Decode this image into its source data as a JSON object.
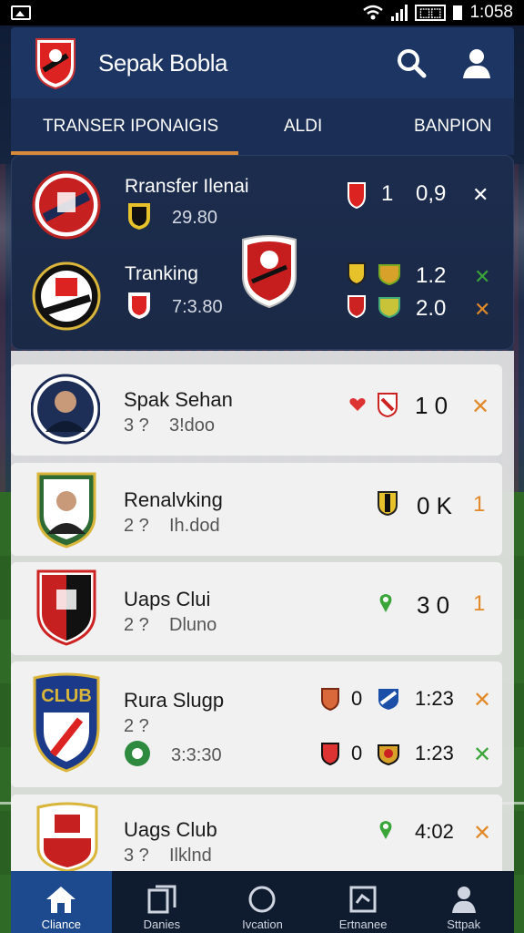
{
  "status_bar": {
    "time": "1:058",
    "battery_label": "⬚⬚"
  },
  "header": {
    "title": "Sepak Bobla"
  },
  "tabs": [
    {
      "label": "TRANSER IPONAIGIS",
      "active": true
    },
    {
      "label": "ALDI",
      "active": false
    },
    {
      "label": "BANPION",
      "active": false
    }
  ],
  "featured": {
    "match1": {
      "title": "Rransfer Ilenai",
      "time": "29.80",
      "score_a": "1",
      "score_b": "0,9",
      "mark": "✕"
    },
    "match2": {
      "title": "Tranking",
      "time": "7:3.80",
      "odds_1": "1.2",
      "odds_2": "2.0",
      "mark_1": "✕",
      "mark_2": "✕"
    }
  },
  "list": [
    {
      "name": "Spak Sehan",
      "sub_a": "3 ?",
      "sub_b": "3!doo",
      "score": "1 0",
      "mark": "✕",
      "mark_color": "orange"
    },
    {
      "name": "Renalvking",
      "sub_a": "2 ?",
      "sub_b": "Ih.dod",
      "score": "0 K",
      "mark": "1",
      "mark_color": "orange"
    },
    {
      "name": "Uaps Clui",
      "sub_a": "2 ?",
      "sub_b": "Dluno",
      "score": "3 0",
      "mark": "1",
      "mark_color": "orange"
    },
    {
      "name": "Rura Slugp",
      "sub_a": "2 ?",
      "time": "3:3:30",
      "row1_score": "0",
      "row1_time": "1:23",
      "row1_mark": "✕",
      "row2_score": "0",
      "row2_time": "1:23",
      "row2_mark": "✕",
      "crest_text": "CLUB"
    },
    {
      "name": "Uags Club",
      "sub_a": "3 ?",
      "sub_b": "Ilklnd",
      "time": "4:02",
      "mark": "✕"
    }
  ],
  "bottom_nav": [
    {
      "label": "Cliance",
      "icon": "home-icon",
      "active": true
    },
    {
      "label": "Danies",
      "icon": "tablet-icon",
      "active": false
    },
    {
      "label": "Ivcation",
      "icon": "circle-icon",
      "active": false
    },
    {
      "label": "Ertnanee",
      "icon": "frame-icon",
      "active": false
    },
    {
      "label": "Sttpak",
      "icon": "player-icon",
      "active": false
    }
  ],
  "colors": {
    "header_bg": "#1c3563",
    "tab_underline": "#d88a3a",
    "nav_active": "#1d4a8e",
    "accent_orange": "#e28a2a",
    "accent_green": "#3aa63a"
  }
}
